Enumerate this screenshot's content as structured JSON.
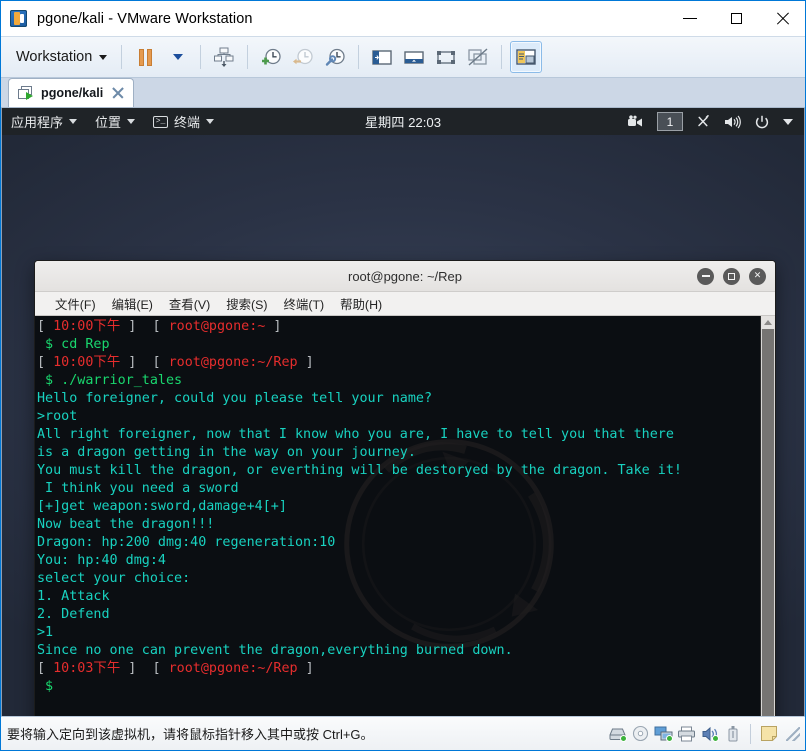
{
  "window": {
    "title": "pgone/kali - VMware Workstation",
    "app_icon": "vmware-icon",
    "minimize_label": "Minimize",
    "maximize_label": "Maximize",
    "close_label": "Close"
  },
  "toolbar": {
    "menu_label": "Workstation",
    "buttons": [
      {
        "name": "pause-vm-button",
        "icon": "pause-icon"
      },
      {
        "name": "pause-dropdown-button",
        "icon": "caret-down-icon"
      },
      {
        "name": "snapshot-manager-button",
        "icon": "snapshot-tree-icon"
      },
      {
        "name": "take-snapshot-button",
        "icon": "clock-plus-icon"
      },
      {
        "name": "revert-snapshot-button",
        "icon": "clock-back-icon"
      },
      {
        "name": "manage-snapshots-button",
        "icon": "clock-wrench-icon"
      },
      {
        "name": "show-library-button",
        "icon": "panel-left-icon"
      },
      {
        "name": "show-thumbnail-bar-button",
        "icon": "panel-bottom-icon"
      },
      {
        "name": "enter-fullscreen-button",
        "icon": "fullscreen-icon"
      },
      {
        "name": "unity-mode-button",
        "icon": "unity-icon"
      },
      {
        "name": "console-view-button",
        "icon": "console-view-icon"
      }
    ]
  },
  "tabs": [
    {
      "label": "pgone/kali",
      "icon": "vm-running-icon",
      "close_icon": "close-icon",
      "active": true
    }
  ],
  "kali_panel": {
    "applications_label": "应用程序",
    "places_label": "位置",
    "terminal_label": "终端",
    "clock": "星期四 22:03",
    "workspace": "1",
    "tray_icons": [
      "screencast-icon",
      "workspace-switcher-icon",
      "bluetooth-icon",
      "volume-icon",
      "power-icon",
      "chevron-down-icon"
    ]
  },
  "terminal": {
    "title": "root@pgone: ~/Rep",
    "menu": [
      "文件(F)",
      "编辑(E)",
      "查看(V)",
      "搜索(S)",
      "终端(T)",
      "帮助(H)"
    ],
    "window_buttons": {
      "minimize": "minimize-icon",
      "maximize": "maximize-icon",
      "close": "close-icon"
    },
    "colors": {
      "background": "#0b0e12",
      "text": "#18d2c0",
      "prompt": "#e62d2d",
      "bracket": "#b8bcc0",
      "command": "#19d76e"
    },
    "lines": [
      {
        "segments": [
          {
            "text": "[ ",
            "color": "bracket"
          },
          {
            "text": "10:00下午",
            "color": "prompt"
          },
          {
            "text": " ]  [ ",
            "color": "bracket"
          },
          {
            "text": "root@pgone:~",
            "color": "prompt"
          },
          {
            "text": " ]",
            "color": "bracket"
          }
        ]
      },
      {
        "segments": [
          {
            "text": " $ cd Rep",
            "color": "command"
          }
        ]
      },
      {
        "segments": [
          {
            "text": "[ ",
            "color": "bracket"
          },
          {
            "text": "10:00下午",
            "color": "prompt"
          },
          {
            "text": " ]  [ ",
            "color": "bracket"
          },
          {
            "text": "root@pgone:~/Rep",
            "color": "prompt"
          },
          {
            "text": " ]",
            "color": "bracket"
          }
        ]
      },
      {
        "segments": [
          {
            "text": " $ ./warrior_tales",
            "color": "command"
          }
        ]
      },
      {
        "segments": [
          {
            "text": "Hello foreigner, could you please tell your name?",
            "color": "text"
          }
        ]
      },
      {
        "segments": [
          {
            "text": ">root",
            "color": "text"
          }
        ]
      },
      {
        "segments": [
          {
            "text": "All right foreigner, now that I know who you are, I have to tell you that there",
            "color": "text"
          }
        ]
      },
      {
        "segments": [
          {
            "text": "is a dragon getting in the way on your journey.",
            "color": "text"
          }
        ]
      },
      {
        "segments": [
          {
            "text": "You must kill the dragon, or everthing will be destoryed by the dragon. Take it!",
            "color": "text"
          }
        ]
      },
      {
        "segments": [
          {
            "text": " I think you need a sword",
            "color": "text"
          }
        ]
      },
      {
        "segments": [
          {
            "text": "[+]get weapon:sword,damage+4[+]",
            "color": "text"
          }
        ]
      },
      {
        "segments": [
          {
            "text": "Now beat the dragon!!!",
            "color": "text"
          }
        ]
      },
      {
        "segments": [
          {
            "text": "Dragon: hp:200 dmg:40 regeneration:10",
            "color": "text"
          }
        ]
      },
      {
        "segments": [
          {
            "text": "You: hp:40 dmg:4",
            "color": "text"
          }
        ]
      },
      {
        "segments": [
          {
            "text": "select your choice:",
            "color": "text"
          }
        ]
      },
      {
        "segments": [
          {
            "text": "1. Attack",
            "color": "text"
          }
        ]
      },
      {
        "segments": [
          {
            "text": "2. Defend",
            "color": "text"
          }
        ]
      },
      {
        "segments": [
          {
            "text": ">1",
            "color": "text"
          }
        ]
      },
      {
        "segments": [
          {
            "text": "Since no one can prevent the dragon,everything burned down.",
            "color": "text"
          }
        ]
      },
      {
        "segments": [
          {
            "text": "[ ",
            "color": "bracket"
          },
          {
            "text": "10:03下午",
            "color": "prompt"
          },
          {
            "text": " ]  [ ",
            "color": "bracket"
          },
          {
            "text": "root@pgone:~/Rep",
            "color": "prompt"
          },
          {
            "text": " ]",
            "color": "bracket"
          }
        ]
      },
      {
        "segments": [
          {
            "text": " $",
            "color": "command"
          }
        ]
      }
    ]
  },
  "statusbar": {
    "message": "要将输入定向到该虚拟机，请将鼠标指针移入其中或按 Ctrl+G。",
    "devices": [
      "hard-disk-icon",
      "cd-dvd-icon",
      "network-adapter-icon",
      "printer-icon",
      "sound-card-icon",
      "usb-icon"
    ],
    "notes_icon": "notes-icon",
    "resize_grip": "resize-grip-icon"
  }
}
